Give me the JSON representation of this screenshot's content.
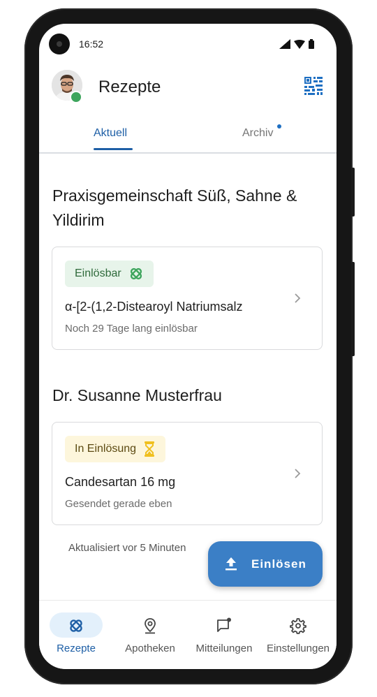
{
  "status_bar": {
    "time": "16:52"
  },
  "header": {
    "title": "Rezepte"
  },
  "tabs": [
    {
      "label": "Aktuell",
      "active": true
    },
    {
      "label": "Archiv",
      "active": false,
      "has_dot": true
    }
  ],
  "sections": [
    {
      "title": "Praxisgemeinschaft Süß, Sahne & Yildirim",
      "card": {
        "badge": "Einlösbar",
        "badge_icon": "pill-icon",
        "title": "α-[2-(1,2-Distearoyl Natriumsalz",
        "subtitle": "Noch 29 Tage lang einlösbar"
      }
    },
    {
      "title": "Dr. Susanne Musterfrau",
      "card": {
        "badge": "In Einlösung",
        "badge_icon": "hourglass-icon",
        "title": "Candesartan 16 mg",
        "subtitle": "Gesendet gerade eben"
      }
    }
  ],
  "updated_text": "Aktualisiert vor 5 Minuten",
  "fab": {
    "label": "Einlösen",
    "icon": "upload-icon"
  },
  "bottom_nav": [
    {
      "label": "Rezepte",
      "icon": "pill-icon",
      "active": true
    },
    {
      "label": "Apotheken",
      "icon": "location-pin-icon",
      "active": false
    },
    {
      "label": "Mitteilungen",
      "icon": "message-icon",
      "active": false
    },
    {
      "label": "Einstellungen",
      "icon": "gear-icon",
      "active": false
    }
  ],
  "colors": {
    "primary": "#1e5fa6",
    "fab": "#3b7fc6",
    "badge_green_bg": "#e7f4ea",
    "badge_green_icon": "#3ea55d",
    "badge_yellow_bg": "#fdf6dc",
    "badge_yellow_icon": "#f0c020",
    "online": "#3ea55d"
  }
}
